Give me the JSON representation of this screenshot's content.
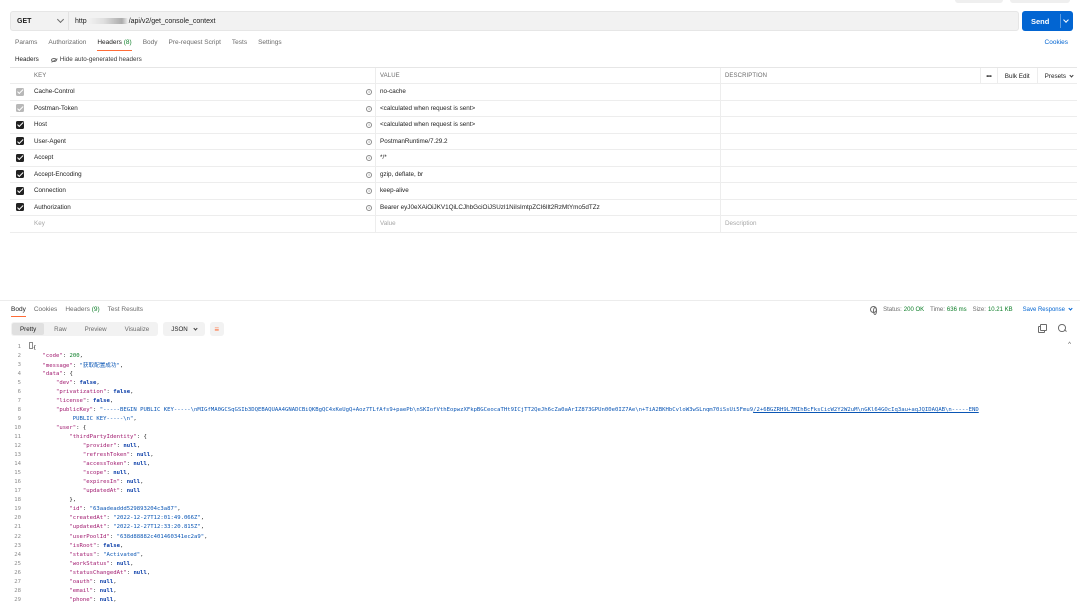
{
  "request": {
    "method": "GET",
    "url_prefix": "http",
    "url_suffix": "/api/v2/get_console_context",
    "send_label": "Send"
  },
  "tabs": [
    {
      "label": "Params",
      "count": ""
    },
    {
      "label": "Authorization",
      "count": ""
    },
    {
      "label": "Headers",
      "count": "(8)"
    },
    {
      "label": "Body",
      "count": ""
    },
    {
      "label": "Pre-request Script",
      "count": ""
    },
    {
      "label": "Tests",
      "count": ""
    },
    {
      "label": "Settings",
      "count": ""
    }
  ],
  "cookies_label": "Cookies",
  "headers_section": {
    "title": "Headers",
    "hide_label": "Hide auto-generated headers",
    "columns": {
      "key": "KEY",
      "value": "VALUE",
      "description": "DESCRIPTION"
    },
    "actions": {
      "more": "•••",
      "bulk_edit": "Bulk Edit",
      "presets": "Presets"
    },
    "rows": [
      {
        "key": "Cache-Control",
        "value": "no-cache",
        "auto": true
      },
      {
        "key": "Postman-Token",
        "value": "<calculated when request is sent>",
        "auto": true
      },
      {
        "key": "Host",
        "value": "<calculated when request is sent>",
        "auto": false
      },
      {
        "key": "User-Agent",
        "value": "PostmanRuntime/7.29.2",
        "auto": false
      },
      {
        "key": "Accept",
        "value": "*/*",
        "auto": false
      },
      {
        "key": "Accept-Encoding",
        "value": "gzip, deflate, br",
        "auto": false
      },
      {
        "key": "Connection",
        "value": "keep-alive",
        "auto": false
      },
      {
        "key": "Authorization",
        "value": "Bearer eyJ0eXAiOiJKV1QiLCJhbGciOiJSUzI1NiIsImtpZCI6Ilt2RzMtYmo5dTZz",
        "auto": false
      }
    ],
    "placeholders": {
      "key": "Key",
      "value": "Value",
      "description": "Description"
    }
  },
  "response": {
    "tabs": [
      {
        "label": "Body",
        "count": ""
      },
      {
        "label": "Cookies",
        "count": ""
      },
      {
        "label": "Headers",
        "count": "(9)"
      },
      {
        "label": "Test Results",
        "count": ""
      }
    ],
    "status_label": "Status:",
    "status_value": "200 OK",
    "time_label": "Time:",
    "time_value": "636 ms",
    "size_label": "Size:",
    "size_value": "10.21 KB",
    "save_label": "Save Response",
    "view_modes": [
      "Pretty",
      "Raw",
      "Preview",
      "Visualize"
    ],
    "format": "JSON",
    "code_lines": [
      [
        [
          "p",
          "{"
        ]
      ],
      [
        [
          "p",
          "    "
        ],
        [
          "k",
          "\"code\""
        ],
        [
          "p",
          ": "
        ],
        [
          "n",
          "200"
        ],
        [
          "p",
          ","
        ]
      ],
      [
        [
          "p",
          "    "
        ],
        [
          "k",
          "\"message\""
        ],
        [
          "p",
          ": "
        ],
        [
          "s",
          "\"获取配置成功\""
        ],
        [
          "p",
          ","
        ]
      ],
      [
        [
          "p",
          "    "
        ],
        [
          "k",
          "\"data\""
        ],
        [
          "p",
          ": {"
        ]
      ],
      [
        [
          "p",
          "        "
        ],
        [
          "k",
          "\"dev\""
        ],
        [
          "p",
          ": "
        ],
        [
          "b",
          "false"
        ],
        [
          "p",
          ","
        ]
      ],
      [
        [
          "p",
          "        "
        ],
        [
          "k",
          "\"privatization\""
        ],
        [
          "p",
          ": "
        ],
        [
          "b",
          "false"
        ],
        [
          "p",
          ","
        ]
      ],
      [
        [
          "p",
          "        "
        ],
        [
          "k",
          "\"license\""
        ],
        [
          "p",
          ": "
        ],
        [
          "b",
          "false"
        ],
        [
          "p",
          ","
        ]
      ],
      [
        [
          "p",
          "        "
        ],
        [
          "k",
          "\"publicKey\""
        ],
        [
          "p",
          ": "
        ],
        [
          "s",
          "\"-----BEGIN PUBLIC KEY-----\\nMIGfMA0GCSqGSIb3DQEBAQUAA4GNADCBiQKBgQC4xKeUgQ+Aoz7TLfAfs9+paePb\\nSKIofVthEopwzXFkpBGCeocaTHt9ICjTT2QeJh6cZa0aArIZ873GPUn00e0IZ7Ae\\n+TiA2BKHbCvloW3wSLnqm70iSsUi5Fmu9"
        ],
        [
          "s u",
          "/2+6BGZRH9L7MIhBcFksCicW2Y2W2uM\\nGKl64GOcIq3au+aqJQIDAQAB\\n-----END"
        ]
      ],
      [
        [
          "p",
          "             "
        ],
        [
          "s",
          "PUBLIC KEY-----\\n\""
        ],
        [
          "p",
          ","
        ]
      ],
      [
        [
          "p",
          "        "
        ],
        [
          "k",
          "\"user\""
        ],
        [
          "p",
          ": {"
        ]
      ],
      [
        [
          "p",
          "            "
        ],
        [
          "k",
          "\"thirdPartyIdentity\""
        ],
        [
          "p",
          ": {"
        ]
      ],
      [
        [
          "p",
          "                "
        ],
        [
          "k",
          "\"provider\""
        ],
        [
          "p",
          ": "
        ],
        [
          "b",
          "null"
        ],
        [
          "p",
          ","
        ]
      ],
      [
        [
          "p",
          "                "
        ],
        [
          "k",
          "\"refreshToken\""
        ],
        [
          "p",
          ": "
        ],
        [
          "b",
          "null"
        ],
        [
          "p",
          ","
        ]
      ],
      [
        [
          "p",
          "                "
        ],
        [
          "k",
          "\"accessToken\""
        ],
        [
          "p",
          ": "
        ],
        [
          "b",
          "null"
        ],
        [
          "p",
          ","
        ]
      ],
      [
        [
          "p",
          "                "
        ],
        [
          "k",
          "\"scope\""
        ],
        [
          "p",
          ": "
        ],
        [
          "b",
          "null"
        ],
        [
          "p",
          ","
        ]
      ],
      [
        [
          "p",
          "                "
        ],
        [
          "k",
          "\"expiresIn\""
        ],
        [
          "p",
          ": "
        ],
        [
          "b",
          "null"
        ],
        [
          "p",
          ","
        ]
      ],
      [
        [
          "p",
          "                "
        ],
        [
          "k",
          "\"updatedAt\""
        ],
        [
          "p",
          ": "
        ],
        [
          "b",
          "null"
        ]
      ],
      [
        [
          "p",
          "            },"
        ]
      ],
      [
        [
          "p",
          "            "
        ],
        [
          "k",
          "\"id\""
        ],
        [
          "p",
          ": "
        ],
        [
          "s",
          "\"63aadeaddd529893204c3a87\""
        ],
        [
          "p",
          ","
        ]
      ],
      [
        [
          "p",
          "            "
        ],
        [
          "k",
          "\"createdAt\""
        ],
        [
          "p",
          ": "
        ],
        [
          "s",
          "\"2022-12-27T12:01:49.066Z\""
        ],
        [
          "p",
          ","
        ]
      ],
      [
        [
          "p",
          "            "
        ],
        [
          "k",
          "\"updatedAt\""
        ],
        [
          "p",
          ": "
        ],
        [
          "s",
          "\"2022-12-27T12:33:20.815Z\""
        ],
        [
          "p",
          ","
        ]
      ],
      [
        [
          "p",
          "            "
        ],
        [
          "k",
          "\"userPoolId\""
        ],
        [
          "p",
          ": "
        ],
        [
          "s",
          "\"638d88882c401460341ec2a9\""
        ],
        [
          "p",
          ","
        ]
      ],
      [
        [
          "p",
          "            "
        ],
        [
          "k",
          "\"isRoot\""
        ],
        [
          "p",
          ": "
        ],
        [
          "b",
          "false"
        ],
        [
          "p",
          ","
        ]
      ],
      [
        [
          "p",
          "            "
        ],
        [
          "k",
          "\"status\""
        ],
        [
          "p",
          ": "
        ],
        [
          "s",
          "\"Activated\""
        ],
        [
          "p",
          ","
        ]
      ],
      [
        [
          "p",
          "            "
        ],
        [
          "k",
          "\"workStatus\""
        ],
        [
          "p",
          ": "
        ],
        [
          "b",
          "null"
        ],
        [
          "p",
          ","
        ]
      ],
      [
        [
          "p",
          "            "
        ],
        [
          "k",
          "\"statusChangedAt\""
        ],
        [
          "p",
          ": "
        ],
        [
          "b",
          "null"
        ],
        [
          "p",
          ","
        ]
      ],
      [
        [
          "p",
          "            "
        ],
        [
          "k",
          "\"oauth\""
        ],
        [
          "p",
          ": "
        ],
        [
          "b",
          "null"
        ],
        [
          "p",
          ","
        ]
      ],
      [
        [
          "p",
          "            "
        ],
        [
          "k",
          "\"email\""
        ],
        [
          "p",
          ": "
        ],
        [
          "b",
          "null"
        ],
        [
          "p",
          ","
        ]
      ],
      [
        [
          "p",
          "            "
        ],
        [
          "k",
          "\"phone\""
        ],
        [
          "p",
          ": "
        ],
        [
          "b",
          "null"
        ],
        [
          "p",
          ","
        ]
      ]
    ]
  }
}
